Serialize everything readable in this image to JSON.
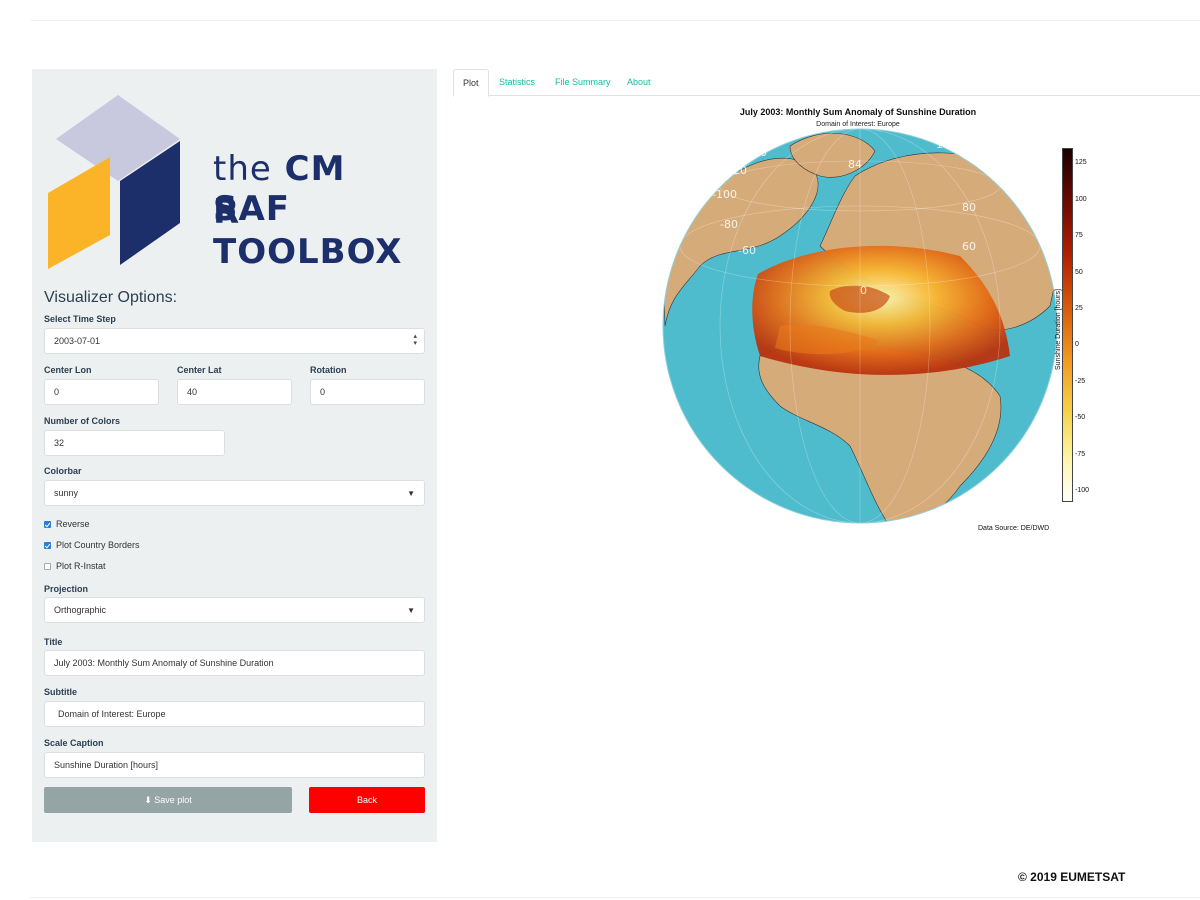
{
  "logo": {
    "word_the": "the",
    "word_cmsaf": "CM SAF",
    "line2": "R TOOLBOX"
  },
  "sidebar": {
    "heading": "Visualizer Options:",
    "time_step": {
      "label": "Select Time Step",
      "value": "2003-07-01"
    },
    "center_lon": {
      "label": "Center Lon",
      "value": "0"
    },
    "center_lat": {
      "label": "Center Lat",
      "value": "40"
    },
    "rotation": {
      "label": "Rotation",
      "value": "0"
    },
    "num_colors": {
      "label": "Number of Colors",
      "value": "32"
    },
    "colorbar": {
      "label": "Colorbar",
      "value": "sunny"
    },
    "checks": [
      {
        "label": "Reverse",
        "checked": true
      },
      {
        "label": "Plot Country Borders",
        "checked": true
      },
      {
        "label": "Plot R-Instat",
        "checked": false
      }
    ],
    "projection": {
      "label": "Projection",
      "value": "Orthographic"
    },
    "title": {
      "label": "Title",
      "value": "July 2003: Monthly Sum Anomaly of Sunshine Duration"
    },
    "subtitle": {
      "label": "Subtitle",
      "value": "Domain of Interest: Europe"
    },
    "scale_caption": {
      "label": "Scale Caption",
      "value": "Sunshine Duration [hours]"
    },
    "save_label": "Save plot",
    "back_label": "Back"
  },
  "tabs": [
    "Plot",
    "Statistics",
    "File Summary",
    "About"
  ],
  "plot": {
    "title": "July 2003: Monthly Sum Anomaly of Sunshine Duration",
    "subtitle": "Domain of Interest: Europe",
    "colorbar_label": "Sunshine Duration [hours]",
    "colorbar_ticks": [
      "125",
      "100",
      "75",
      "50",
      "25",
      "0",
      "-25",
      "-50",
      "-75",
      "-100"
    ],
    "graticule_labels": [
      "-140",
      "-120",
      "-100",
      "-80",
      "-60",
      "84",
      "140",
      "80",
      "60",
      "0"
    ],
    "data_source": "Data Source: DE/DWD"
  },
  "footer": {
    "copyright": "© 2019 EUMETSAT"
  },
  "colors": {
    "accent": "#18bc9c",
    "back": "#ff0000",
    "save": "#95a5a6",
    "ocean": "#4fbccd",
    "land": "#d6ab7a"
  }
}
